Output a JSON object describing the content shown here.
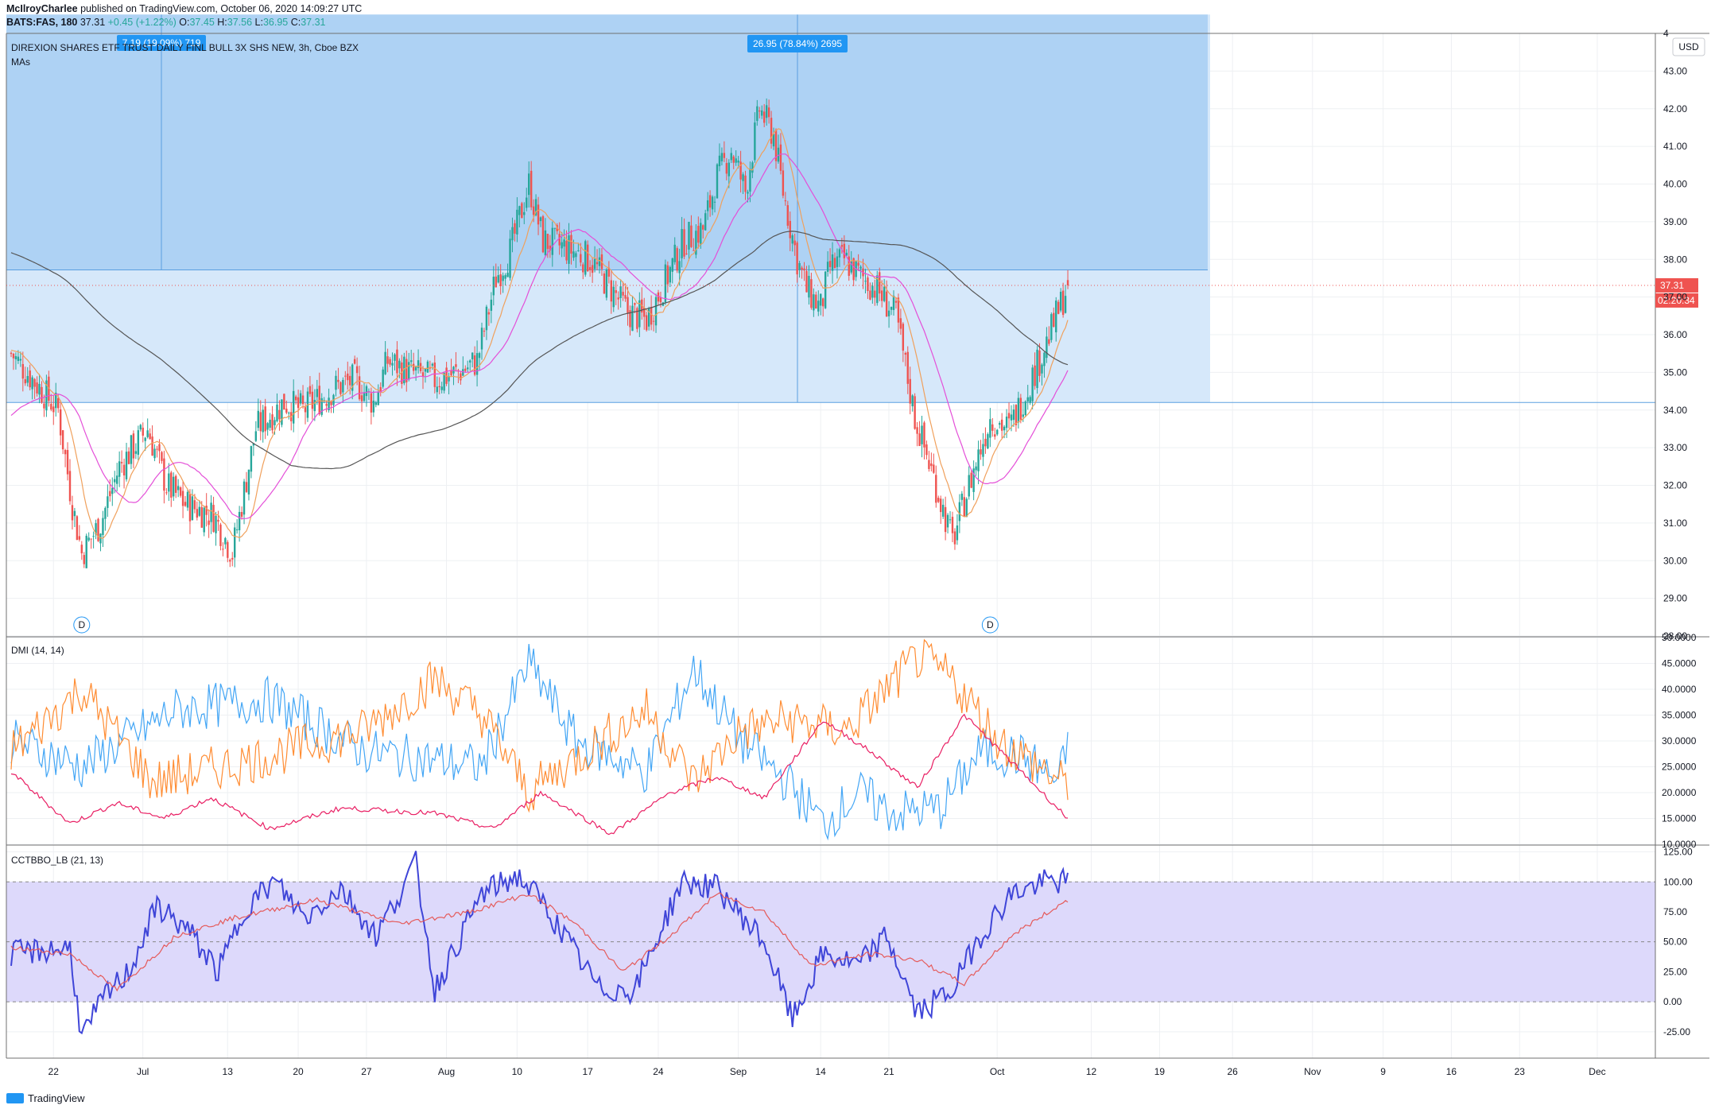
{
  "header": {
    "author": "McIlroyCharlee",
    "published": "published on TradingView.com, October 06, 2020 14:09:27 UTC",
    "symbol_line": "BATS:FAS, 180",
    "last": "37.31",
    "change": "+0.45 (+1.22%)",
    "open_label": "O:",
    "open": "37.45",
    "high_label": "H:",
    "high": "37.56",
    "low_label": "L:",
    "low": "36.95",
    "close_label": "C:",
    "close": "37.31"
  },
  "main_pane": {
    "title": "DIREXION SHARES ETF TRUST DAILY FINL BULL 3X SHS NEW, 3h, Cboe BZX",
    "indicator": "MAs",
    "currency": "USD",
    "price_tag": "37.31",
    "countdown_tag": "02:20:34",
    "measure_tag_1": "7.19 (19.09%) 719",
    "measure_tag_2": "26.95 (78.84%) 2695",
    "dividend_marker": "D"
  },
  "dmi_pane": {
    "title": "DMI (14, 14)"
  },
  "cct_pane": {
    "title": "CCTBBO_LB (21, 13)"
  },
  "branding": {
    "logo": "TradingView"
  },
  "colors": {
    "up": "#26a69a",
    "down": "#ef5350",
    "ma_fast": "#f0a05c",
    "ma_mid": "#e44fd8",
    "ma_slow": "#555555",
    "dmi_plus": "#42a5f5",
    "dmi_minus": "#ff8c32",
    "adx": "#e91e63",
    "cct": "#3f45d8",
    "cct_signal": "#e55a5a",
    "band": "#ddd9fb",
    "zone": "#bbdefb",
    "measure": "#9ccaf0"
  },
  "chart_data": [
    {
      "type": "candlestick",
      "pane": "price",
      "ylim": [
        28,
        44
      ],
      "y_ticks": [
        "28.00",
        "29.00",
        "30.00",
        "31.00",
        "32.00",
        "33.00",
        "34.00",
        "35.00",
        "36.00",
        "37.00",
        "38.00",
        "39.00",
        "40.00",
        "41.00",
        "42.00",
        "43.00",
        "4"
      ],
      "x_ticks": [
        "22",
        "Jul",
        "13",
        "20",
        "27",
        "Aug",
        "10",
        "17",
        "24",
        "Sep",
        "14",
        "21",
        "Oct",
        "12",
        "19",
        "26",
        "Nov",
        "9",
        "16",
        "23",
        "Dec"
      ],
      "x_tick_pos": [
        20,
        58,
        94,
        124,
        153,
        187,
        217,
        247,
        277,
        311,
        346,
        375,
        421,
        461,
        490,
        521,
        555,
        585,
        614,
        643,
        676
      ],
      "n_bars_visible": 770,
      "closes_keypoints": [
        [
          0,
          35.5
        ],
        [
          20,
          34.0
        ],
        [
          26,
          31.5
        ],
        [
          30,
          30.2
        ],
        [
          38,
          31.0
        ],
        [
          46,
          32.5
        ],
        [
          58,
          33.5
        ],
        [
          66,
          32.0
        ],
        [
          74,
          31.5
        ],
        [
          86,
          31.2
        ],
        [
          94,
          30.2
        ],
        [
          104,
          33.5
        ],
        [
          116,
          34.2
        ],
        [
          124,
          34.0
        ],
        [
          138,
          34.6
        ],
        [
          146,
          34.8
        ],
        [
          154,
          34.2
        ],
        [
          160,
          35.3
        ],
        [
          170,
          35.0
        ],
        [
          180,
          34.8
        ],
        [
          190,
          35.0
        ],
        [
          198,
          35.3
        ],
        [
          206,
          37.5
        ],
        [
          212,
          38.2
        ],
        [
          220,
          40.0
        ],
        [
          226,
          38.5
        ],
        [
          236,
          38.3
        ],
        [
          246,
          38.0
        ],
        [
          254,
          37.3
        ],
        [
          262,
          36.6
        ],
        [
          270,
          36.4
        ],
        [
          277,
          37.3
        ],
        [
          286,
          38.5
        ],
        [
          294,
          38.8
        ],
        [
          300,
          40.2
        ],
        [
          306,
          40.9
        ],
        [
          312,
          39.8
        ],
        [
          318,
          42.0
        ],
        [
          324,
          41.3
        ],
        [
          328,
          39.8
        ],
        [
          334,
          38.0
        ],
        [
          338,
          37.2
        ],
        [
          344,
          36.7
        ],
        [
          348,
          37.8
        ],
        [
          354,
          38.0
        ],
        [
          360,
          37.6
        ],
        [
          368,
          37.2
        ],
        [
          376,
          36.5
        ],
        [
          384,
          33.8
        ],
        [
          392,
          32.2
        ],
        [
          400,
          30.5
        ],
        [
          406,
          31.8
        ],
        [
          416,
          33.8
        ],
        [
          424,
          33.5
        ],
        [
          432,
          34.6
        ],
        [
          440,
          35.8
        ],
        [
          446,
          36.8
        ],
        [
          449,
          37.31
        ]
      ],
      "measure_1": {
        "from": 34.2,
        "to": 37.72,
        "label": "7.19 (19.09%) 719"
      },
      "measure_2": {
        "from": 34.2,
        "to": 44.5,
        "label": "26.95 (78.84%) 2695"
      },
      "series": [
        {
          "name": "MA fast",
          "color": "#f0a05c"
        },
        {
          "name": "MA mid",
          "color": "#e44fd8"
        },
        {
          "name": "MA slow",
          "color": "#555555"
        }
      ]
    },
    {
      "type": "line",
      "pane": "DMI (14, 14)",
      "ylim": [
        10,
        50
      ],
      "y_ticks": [
        "10.0000",
        "15.0000",
        "20.0000",
        "25.0000",
        "30.0000",
        "35.0000",
        "40.0000",
        "45.0000",
        "50.0000"
      ],
      "series": [
        {
          "name": "+DI",
          "color": "#42a5f5",
          "keypoints": [
            [
              0,
              30
            ],
            [
              30,
              25
            ],
            [
              70,
              36
            ],
            [
              110,
              38
            ],
            [
              150,
              28
            ],
            [
              200,
              25
            ],
            [
              220,
              45
            ],
            [
              240,
              30
            ],
            [
              270,
              24
            ],
            [
              290,
              44
            ],
            [
              310,
              30
            ],
            [
              330,
              22
            ],
            [
              345,
              14
            ],
            [
              360,
              20
            ],
            [
              375,
              16
            ],
            [
              395,
              17
            ],
            [
              412,
              28
            ],
            [
              430,
              27
            ],
            [
              445,
              22
            ],
            [
              449,
              29
            ]
          ]
        },
        {
          "name": "-DI",
          "color": "#ff8c32",
          "keypoints": [
            [
              0,
              28
            ],
            [
              30,
              40
            ],
            [
              60,
              22
            ],
            [
              100,
              26
            ],
            [
              150,
              32
            ],
            [
              180,
              42
            ],
            [
              200,
              35
            ],
            [
              220,
              20
            ],
            [
              250,
              30
            ],
            [
              270,
              36
            ],
            [
              290,
              22
            ],
            [
              310,
              32
            ],
            [
              330,
              34
            ],
            [
              355,
              32
            ],
            [
              385,
              46
            ],
            [
              400,
              42
            ],
            [
              420,
              30
            ],
            [
              440,
              24
            ],
            [
              449,
              21
            ]
          ]
        },
        {
          "name": "ADX",
          "color": "#e91e63",
          "keypoints": [
            [
              0,
              24
            ],
            [
              25,
              14
            ],
            [
              45,
              18
            ],
            [
              65,
              15
            ],
            [
              85,
              19
            ],
            [
              110,
              13
            ],
            [
              140,
              17
            ],
            [
              180,
              16
            ],
            [
              205,
              13
            ],
            [
              225,
              20
            ],
            [
              255,
              12
            ],
            [
              280,
              20
            ],
            [
              300,
              23
            ],
            [
              320,
              19
            ],
            [
              345,
              34
            ],
            [
              365,
              28
            ],
            [
              385,
              21
            ],
            [
              405,
              35
            ],
            [
              425,
              26
            ],
            [
              449,
              15
            ]
          ]
        }
      ]
    },
    {
      "type": "line",
      "pane": "CCTBBO_LB (21, 13)",
      "ylim": [
        -47,
        130
      ],
      "y_ticks": [
        "-25.00",
        "0.00",
        "25.00",
        "50.00",
        "75.00",
        "100.00",
        "125.00"
      ],
      "band": [
        0,
        100
      ],
      "series": [
        {
          "name": "CCT",
          "color": "#3f45d8",
          "keypoints": [
            [
              0,
              40
            ],
            [
              25,
              45
            ],
            [
              30,
              -30
            ],
            [
              40,
              5
            ],
            [
              50,
              25
            ],
            [
              62,
              80
            ],
            [
              75,
              60
            ],
            [
              88,
              25
            ],
            [
              100,
              80
            ],
            [
              112,
              100
            ],
            [
              125,
              70
            ],
            [
              140,
              95
            ],
            [
              155,
              55
            ],
            [
              172,
              115
            ],
            [
              180,
              10
            ],
            [
              200,
              90
            ],
            [
              215,
              105
            ],
            [
              225,
              85
            ],
            [
              250,
              10
            ],
            [
              265,
              10
            ],
            [
              285,
              100
            ],
            [
              300,
              95
            ],
            [
              320,
              50
            ],
            [
              332,
              -15
            ],
            [
              345,
              40
            ],
            [
              360,
              30
            ],
            [
              372,
              55
            ],
            [
              385,
              -10
            ],
            [
              400,
              10
            ],
            [
              410,
              50
            ],
            [
              425,
              90
            ],
            [
              440,
              100
            ],
            [
              449,
              100
            ]
          ]
        },
        {
          "name": "Signal",
          "color": "#e55a5a",
          "keypoints": [
            [
              0,
              45
            ],
            [
              25,
              40
            ],
            [
              45,
              10
            ],
            [
              70,
              55
            ],
            [
              95,
              70
            ],
            [
              130,
              85
            ],
            [
              165,
              65
            ],
            [
              195,
              75
            ],
            [
              220,
              90
            ],
            [
              240,
              65
            ],
            [
              260,
              25
            ],
            [
              280,
              55
            ],
            [
              300,
              90
            ],
            [
              320,
              75
            ],
            [
              340,
              30
            ],
            [
              365,
              40
            ],
            [
              385,
              35
            ],
            [
              405,
              15
            ],
            [
              425,
              55
            ],
            [
              449,
              85
            ]
          ]
        }
      ]
    }
  ]
}
